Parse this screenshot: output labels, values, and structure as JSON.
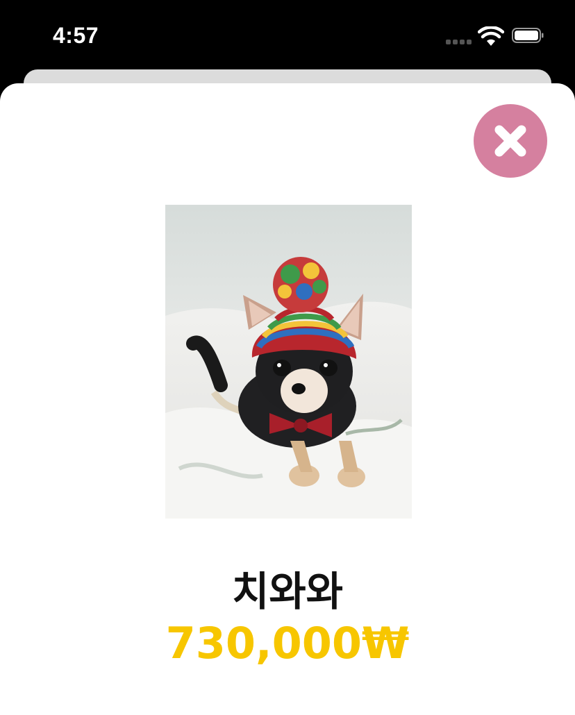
{
  "status_bar": {
    "time": "4:57",
    "wifi_icon": "wifi-icon",
    "battery_icon": "battery-icon"
  },
  "detail": {
    "close_icon": "close-icon",
    "image_subject": "chihuahua-in-knitted-hat-photo",
    "name": "치와와",
    "price": "730,000₩"
  },
  "colors": {
    "close_button": "#d5809f",
    "price": "#f7c600",
    "background": "#000000",
    "sheet": "#ffffff"
  }
}
